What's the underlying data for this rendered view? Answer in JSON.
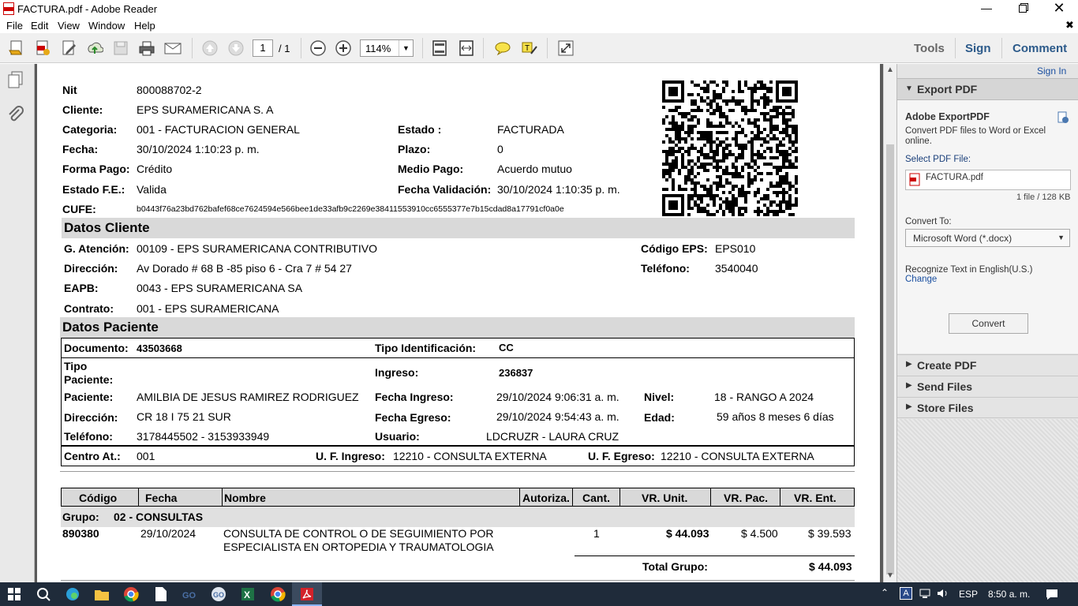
{
  "window": {
    "title": "FACTURA.pdf - Adobe Reader"
  },
  "menu": [
    "File",
    "Edit",
    "View",
    "Window",
    "Help"
  ],
  "toolbar": {
    "page_current": "1",
    "page_total": "/ 1",
    "zoom": "114%",
    "tools": "Tools",
    "sign": "Sign",
    "comment": "Comment"
  },
  "invoice": {
    "nit_label": "Nit",
    "nit": "800088702-2",
    "cliente_label": "Cliente:",
    "cliente": "EPS SURAMERICANA S. A",
    "categoria_label": "Categoria:",
    "categoria": "001 - FACTURACION GENERAL",
    "estado_label": "Estado :",
    "estado": "FACTURADA",
    "fecha_label": "Fecha:",
    "fecha": "30/10/2024 1:10:23 p. m.",
    "plazo_label": "Plazo:",
    "plazo": "0",
    "forma_pago_label": "Forma Pago:",
    "forma_pago": "Crédito",
    "medio_pago_label": "Medio Pago:",
    "medio_pago": "Acuerdo mutuo",
    "estado_fe_label": "Estado F.E.:",
    "estado_fe": "Valida",
    "fecha_validacion_label": "Fecha Validación:",
    "fecha_validacion": "30/10/2024 1:10:35 p. m.",
    "cufe_label": "CUFE:",
    "cufe": "b0443f76a23bd762bafef68ce7624594e566bee1de33afb9c2269e38411553910cc6555377e7b15cdad8a17791cf0a0e"
  },
  "datos_cliente": {
    "title": "Datos Cliente",
    "atencion_label": "G. Atención:",
    "atencion": "00109 - EPS SURAMERICANA CONTRIBUTIVO",
    "codigo_eps_label": "Código EPS:",
    "codigo_eps": "EPS010",
    "direccion_label": "Dirección:",
    "direccion": "Av Dorado # 68 B -85 piso 6 - Cra 7 # 54  27",
    "telefono_label": "Teléfono:",
    "telefono": "3540040",
    "eapb_label": "EAPB:",
    "eapb": "0043 - EPS SURAMERICANA SA",
    "contrato_label": "Contrato:",
    "contrato": "001 - EPS SURAMERICANA"
  },
  "datos_paciente": {
    "title": "Datos Paciente",
    "documento_label": "Documento:",
    "documento": "43503668",
    "tipo_id_label": "Tipo Identificación:",
    "tipo_id": "CC",
    "tipo_paciente_label1": "Tipo",
    "tipo_paciente_label2": "Paciente:",
    "ingreso_label": "Ingreso:",
    "ingreso": "236837",
    "paciente_label": "Paciente:",
    "paciente": "AMILBIA DE JESUS RAMIREZ RODRIGUEZ",
    "fecha_ingreso_label": "Fecha Ingreso:",
    "fecha_ingreso": "29/10/2024 9:06:31 a. m.",
    "nivel_label": "Nivel:",
    "nivel": "18 - RANGO A 2024",
    "direccion_label": "Dirección:",
    "direccion": "CR 18 I 75 21 SUR",
    "fecha_egreso_label": "Fecha Egreso:",
    "fecha_egreso": "29/10/2024 9:54:43 a. m.",
    "edad_label": "Edad:",
    "edad": "59 años 8 meses  6 días",
    "telefono_label": "Teléfono:",
    "telefono": "3178445502 - 3153933949",
    "usuario_label": "Usuario:",
    "usuario": "LDCRUZR - LAURA CRUZ",
    "centro_label": "Centro At.:",
    "centro": "001",
    "uf_ingreso_label": "U. F. Ingreso:",
    "uf_ingreso": "12210 - CONSULTA EXTERNA",
    "uf_egreso_label": "U. F. Egreso:",
    "uf_egreso": "12210 - CONSULTA EXTERNA"
  },
  "table": {
    "headers": [
      "Código",
      "Fecha",
      "Nombre",
      "Autoriza.",
      "Cant.",
      "VR. Unit.",
      "VR. Pac.",
      "VR. Ent."
    ],
    "grupo_label": "Grupo:",
    "grupo": "02 - CONSULTAS",
    "row": {
      "codigo": "890380",
      "fecha": "29/10/2024",
      "nombre1": "CONSULTA DE CONTROL O DE SEGUIMIENTO POR",
      "nombre2": "ESPECIALISTA EN ORTOPEDIA Y TRAUMATOLOGIA",
      "cant": "1",
      "vr_unit": "$ 44.093",
      "vr_pac": "$ 4.500",
      "vr_ent": "$ 39.593"
    },
    "total_label": "Total Grupo:",
    "total": "$ 44.093"
  },
  "right_panel": {
    "sign_in": "Sign In",
    "export_pdf": "Export PDF",
    "adobe_export": "Adobe ExportPDF",
    "desc": "Convert PDF files to Word or Excel online.",
    "select_file": "Select PDF File:",
    "file_name": "FACTURA.pdf",
    "file_info": "1 file / 128 KB",
    "convert_to": "Convert To:",
    "format": "Microsoft Word (*.docx)",
    "recognize": "Recognize Text in English(U.S.)",
    "change": "Change",
    "convert_btn": "Convert",
    "create_pdf": "Create PDF",
    "send_files": "Send Files",
    "store_files": "Store Files"
  },
  "taskbar": {
    "lang": "ESP",
    "time": "8:50 a. m."
  }
}
